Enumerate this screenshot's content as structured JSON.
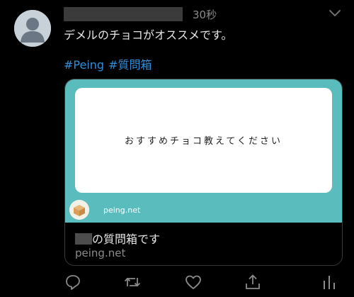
{
  "tweet": {
    "time": "30秒",
    "text": "デメルのチョコがオススメです。",
    "hashtags": [
      "#Peing",
      "#質問箱"
    ]
  },
  "card": {
    "question": "おすすめチョコ教えてください",
    "site_label": "peing.net",
    "title_suffix": "の質問箱です",
    "domain": "peing.net"
  },
  "actions": [
    "reply-icon",
    "retweet-icon",
    "like-icon",
    "share-icon",
    "analytics-icon"
  ],
  "colors": {
    "background": "#000000",
    "link": "#2f8fd8",
    "card_teal": "#5bbcbd",
    "muted": "#8b8b8b"
  }
}
